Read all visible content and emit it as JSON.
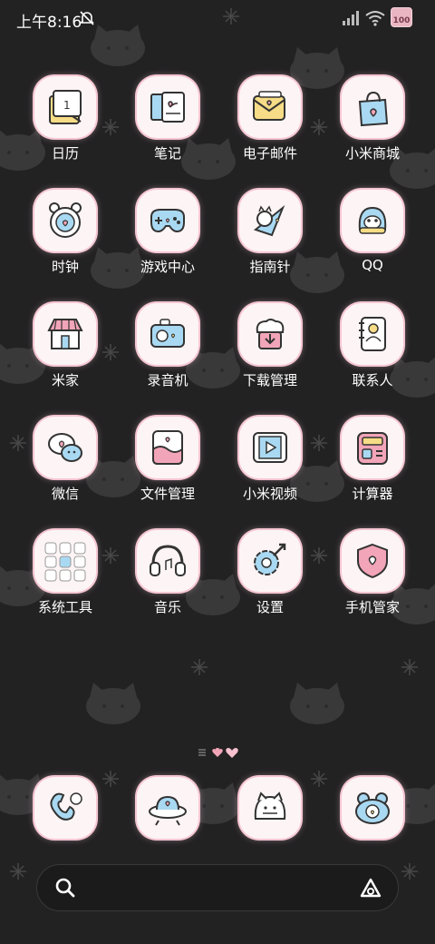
{
  "status_bar": {
    "time": "上午8:16",
    "battery": "100"
  },
  "apps": [
    {
      "label": "日历",
      "icon": "calendar-icon"
    },
    {
      "label": "笔记",
      "icon": "notes-icon"
    },
    {
      "label": "电子邮件",
      "icon": "email-icon"
    },
    {
      "label": "小米商城",
      "icon": "shopping-bag-icon"
    },
    {
      "label": "时钟",
      "icon": "clock-icon"
    },
    {
      "label": "游戏中心",
      "icon": "gamepad-icon"
    },
    {
      "label": "指南针",
      "icon": "compass-icon"
    },
    {
      "label": "QQ",
      "icon": "qq-penguin-icon"
    },
    {
      "label": "米家",
      "icon": "home-store-icon"
    },
    {
      "label": "录音机",
      "icon": "recorder-icon"
    },
    {
      "label": "下载管理",
      "icon": "download-cloud-icon"
    },
    {
      "label": "联系人",
      "icon": "contacts-book-icon"
    },
    {
      "label": "微信",
      "icon": "wechat-bubble-icon"
    },
    {
      "label": "文件管理",
      "icon": "file-folder-icon"
    },
    {
      "label": "小米视频",
      "icon": "video-film-icon"
    },
    {
      "label": "计算器",
      "icon": "calculator-icon"
    },
    {
      "label": "系统工具",
      "icon": "system-tools-folder-icon"
    },
    {
      "label": "音乐",
      "icon": "headphones-icon"
    },
    {
      "label": "设置",
      "icon": "settings-gear-icon"
    },
    {
      "label": "手机管家",
      "icon": "security-shield-icon"
    }
  ],
  "dock": [
    {
      "icon": "phone-icon"
    },
    {
      "icon": "messages-ufo-icon"
    },
    {
      "icon": "browser-cat-icon"
    },
    {
      "icon": "camera-frog-icon"
    }
  ],
  "colors": {
    "background": "#232223",
    "tile": "#fdf4f5",
    "tile_ring": "#f5c6d2",
    "accent_pink": "#f2a5b8",
    "accent_blue": "#a9d9f2",
    "accent_yellow": "#f6dc86"
  }
}
